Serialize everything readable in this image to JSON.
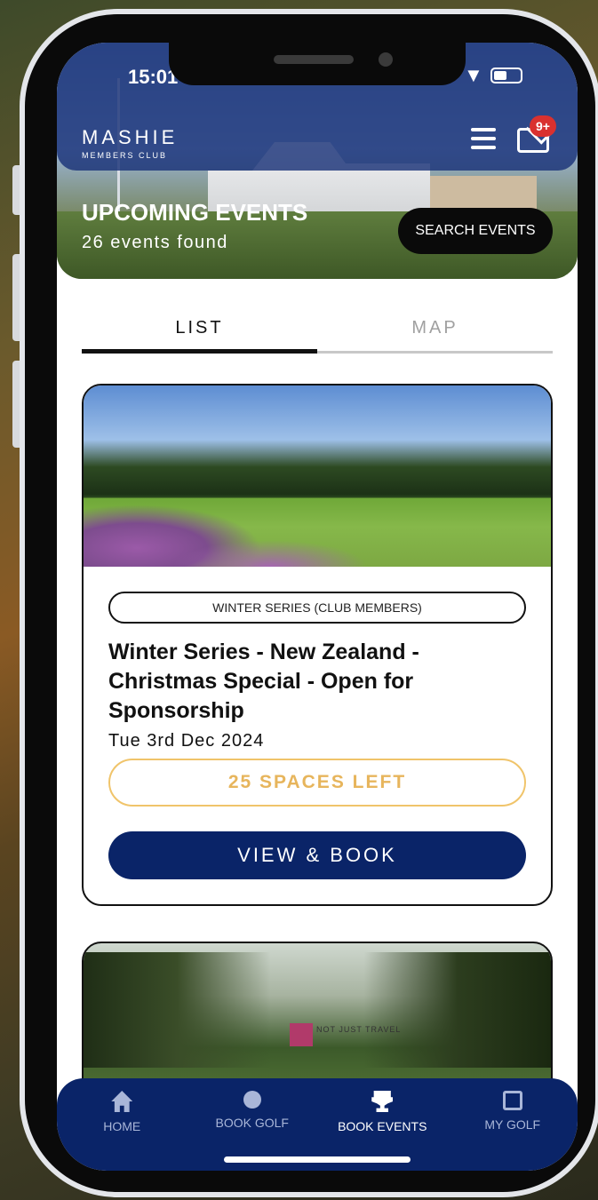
{
  "status": {
    "time": "15:01"
  },
  "brand": {
    "name": "MASHIE",
    "sub": "MEMBERS CLUB"
  },
  "notifications": {
    "badge": "9+"
  },
  "hero": {
    "title": "UPCOMING EVENTS",
    "count": "26 events found",
    "search_label": "SEARCH EVENTS"
  },
  "tabs": [
    {
      "label": "LIST",
      "active": true
    },
    {
      "label": "MAP",
      "active": false
    }
  ],
  "events": [
    {
      "tag": "WINTER SERIES (CLUB MEMBERS)",
      "title": "Winter Series - New Zealand - Christmas Special -  Open for Sponsorship",
      "date": "Tue 3rd Dec 2024",
      "spaces": "25 SPACES LEFT",
      "book_label": "VIEW & BOOK"
    },
    {
      "logo_text": "NOT JUST TRAVEL"
    }
  ],
  "nav": {
    "items": [
      {
        "label": "HOME",
        "icon": "home-icon"
      },
      {
        "label": "BOOK GOLF",
        "icon": "golf-ball-icon"
      },
      {
        "label": "BOOK EVENTS",
        "icon": "trophy-icon"
      },
      {
        "label": "MY GOLF",
        "icon": "calendar-icon"
      }
    ],
    "active": "BOOK EVENTS"
  },
  "colors": {
    "navy": "#0a2468",
    "accent": "#e7b55c",
    "badge": "#d9312f"
  }
}
